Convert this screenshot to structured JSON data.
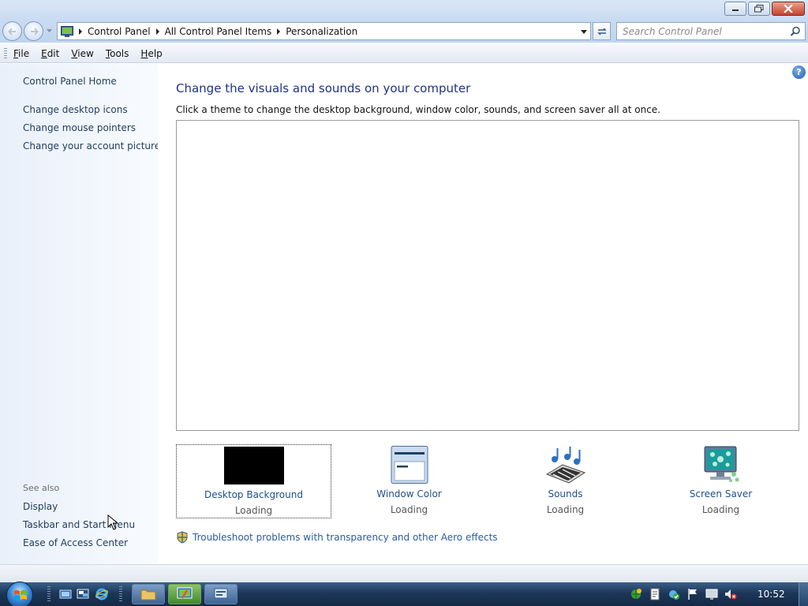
{
  "window": {
    "controls": [
      "minimize-icon",
      "restore-icon",
      "close-icon"
    ]
  },
  "address_bar": {
    "crumbs": [
      "Control Panel",
      "All Control Panel Items",
      "Personalization"
    ],
    "search_placeholder": "Search Control Panel"
  },
  "menu": {
    "items": [
      {
        "label": "File",
        "mnemonic": "F",
        "rest": "ile"
      },
      {
        "label": "Edit",
        "mnemonic": "E",
        "rest": "dit"
      },
      {
        "label": "View",
        "mnemonic": "V",
        "rest": "iew"
      },
      {
        "label": "Tools",
        "mnemonic": "T",
        "rest": "ools"
      },
      {
        "label": "Help",
        "mnemonic": "H",
        "rest": "elp"
      }
    ]
  },
  "sidebar": {
    "home": "Control Panel Home",
    "tasks": [
      "Change desktop icons",
      "Change mouse pointers",
      "Change your account picture"
    ],
    "see_also_title": "See also",
    "see_also": [
      "Display",
      "Taskbar and Start Menu",
      "Ease of Access Center"
    ]
  },
  "main": {
    "heading": "Change the visuals and sounds on your computer",
    "subtext": "Click a theme to change the desktop background, window color, sounds, and screen saver all at once.",
    "tiles": [
      {
        "label": "Desktop Background",
        "status": "Loading",
        "icon": "desktop-background-icon"
      },
      {
        "label": "Window Color",
        "status": "Loading",
        "icon": "window-color-icon"
      },
      {
        "label": "Sounds",
        "status": "Loading",
        "icon": "sounds-icon"
      },
      {
        "label": "Screen Saver",
        "status": "Loading",
        "icon": "screen-saver-icon"
      }
    ],
    "troubleshoot_link": "Troubleshoot problems with transparency and other Aero effects"
  },
  "taskbar": {
    "clock": "10:52",
    "pinned": [
      "explorer-icon",
      "remote-desktop-icon",
      "internet-explorer-icon"
    ],
    "open_apps": [
      "file-explorer-app",
      "personalization-app",
      "remote-app"
    ],
    "tray": [
      "network-icon",
      "notes-icon",
      "security-icon",
      "flag-icon",
      "display-icon",
      "volume-muted-icon"
    ]
  },
  "colors": {
    "heading": "#1e3287",
    "link": "#1e3c5d",
    "taskbar": "#1d3758"
  }
}
